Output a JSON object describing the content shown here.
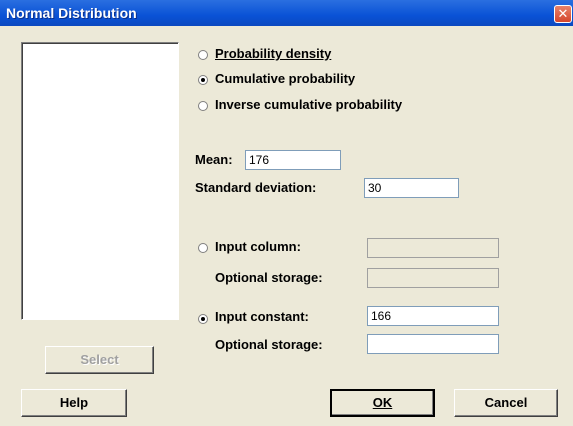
{
  "window": {
    "title": "Normal Distribution",
    "close_glyph": "✕"
  },
  "listbox": {
    "items": []
  },
  "buttons": {
    "select": "Select",
    "help": "Help",
    "ok": "OK",
    "cancel": "Cancel"
  },
  "distribution_options": [
    {
      "label": "Probability density",
      "selected": false
    },
    {
      "label": "Cumulative probability",
      "selected": true
    },
    {
      "label": "Inverse cumulative probability",
      "selected": false
    }
  ],
  "params": {
    "mean_label": "Mean:",
    "mean_value": "176",
    "sd_label": "Standard deviation:",
    "sd_value": "30"
  },
  "input": {
    "column_label": "Input column:",
    "column_value": "",
    "column_storage_label": "Optional storage:",
    "column_storage_value": "",
    "column_selected": false,
    "constant_label": "Input constant:",
    "constant_value": "166",
    "constant_storage_label": "Optional storage:",
    "constant_storage_value": "",
    "constant_selected": true
  }
}
